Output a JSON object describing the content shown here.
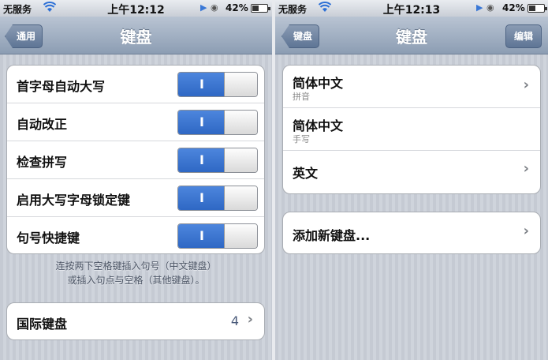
{
  "left": {
    "status": {
      "carrier": "无服务",
      "time": "上午12:12",
      "battery": "42%",
      "battery_level": 0.42
    },
    "nav": {
      "back_label": "通用",
      "title": "键盘"
    },
    "settings": [
      {
        "label": "首字母自动大写",
        "toggle": "I",
        "on": true
      },
      {
        "label": "自动改正",
        "toggle": "I",
        "on": true
      },
      {
        "label": "检查拼写",
        "toggle": "I",
        "on": true
      },
      {
        "label": "启用大写字母锁定键",
        "toggle": "I",
        "on": true
      },
      {
        "label": "句号快捷键",
        "toggle": "I",
        "on": true
      }
    ],
    "footnote_line1": "连按两下空格键插入句号（中文键盘）",
    "footnote_line2": "或插入句点与空格（其他键盘）。",
    "international": {
      "label": "国际键盘",
      "count": "4",
      "chevron": "›"
    }
  },
  "right": {
    "status": {
      "carrier": "无服务",
      "time": "上午12:13",
      "battery": "42%",
      "battery_level": 0.42
    },
    "nav": {
      "back_label": "键盘",
      "title": "键盘",
      "edit_label": "编辑"
    },
    "keyboards": [
      {
        "label": "简体中文",
        "sub": "拼音",
        "chevron": "›"
      },
      {
        "label": "简体中文",
        "sub": "手写",
        "chevron": ""
      },
      {
        "label": "英文",
        "sub": "",
        "chevron": "›"
      }
    ],
    "add": {
      "label": "添加新键盘...",
      "chevron": "›"
    }
  },
  "icons": {
    "wifi": "wifi-icon",
    "play": "play-icon",
    "lock": "rotation-lock-icon",
    "chevron": "chevron-right-icon"
  }
}
